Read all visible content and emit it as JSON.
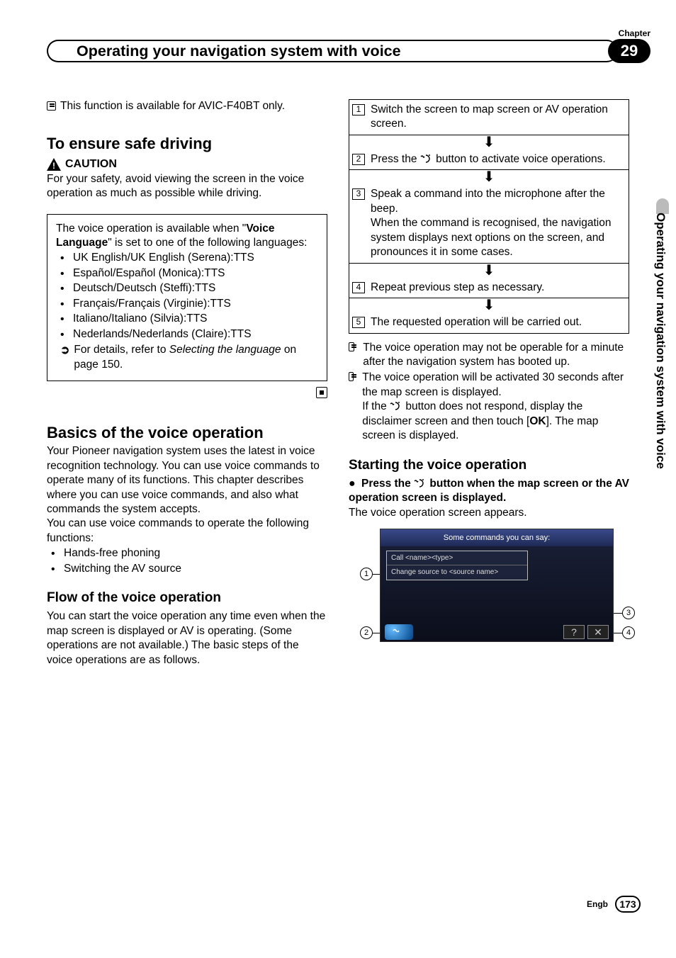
{
  "header": {
    "chapter_label": "Chapter",
    "title": "Operating your navigation system with voice",
    "chapter_num": "29",
    "side_tab": "Operating your navigation system with voice"
  },
  "left": {
    "top_note": "This function is available for AVIC-F40BT only.",
    "h_ensure": "To ensure safe driving",
    "caution_label": "CAUTION",
    "caution_body": "For your safety, avoid viewing the screen in the voice operation as much as possible while driving.",
    "box_intro_1": "The voice operation is available when \"",
    "box_intro_bold": "Voice Language",
    "box_intro_2": "\" is set to one of the following languages:",
    "langs": [
      "UK English/UK English (Serena):TTS",
      "Español/Español (Monica):TTS",
      "Deutsch/Deutsch (Steffi):TTS",
      "Français/Français (Virginie):TTS",
      "Italiano/Italiano (Silvia):TTS",
      "Nederlands/Nederlands (Claire):TTS"
    ],
    "ref_text_1": "For details, refer to ",
    "ref_text_italic": "Selecting the language",
    "ref_text_2": " on page 150.",
    "h_basics": "Basics of the voice operation",
    "basics_p1": "Your Pioneer navigation system uses the latest in voice recognition technology. You can use voice commands to operate many of its functions. This chapter describes where you can use voice commands, and also what commands the system accepts.",
    "basics_p2": "You can use voice commands to operate the following functions:",
    "basics_funcs": [
      "Hands-free phoning",
      "Switching the AV source"
    ],
    "h_flow": "Flow of the voice operation",
    "flow_p": "You can start the voice operation any time even when the map screen is displayed or AV is operating. (Some operations are not available.) The basic steps of the voice operations are as follows."
  },
  "right": {
    "steps": [
      "Switch the screen to map screen or AV operation screen.",
      "Press the  button to activate voice operations.",
      "Speak a command into the microphone after the beep.\nWhen the command is recognised, the navigation system displays next options on the screen, and pronounces it in some cases.",
      "Repeat previous step as necessary.",
      "The requested operation will be carried out."
    ],
    "step_nums": [
      "1",
      "2",
      "3",
      "4",
      "5"
    ],
    "note1": "The voice operation may not be operable for a minute after the navigation system has booted up.",
    "note2a": "The voice operation will be activated 30 seconds after the map screen is displayed.",
    "note2b_1": "If the ",
    "note2b_2": " button does not respond, display the disclaimer screen and then touch [",
    "note2b_ok": "OK",
    "note2b_3": "]. The map screen is displayed.",
    "h_start": "Starting the voice operation",
    "start_b1": "Press the ",
    "start_b2": " button when the map screen or the AV operation screen is displayed.",
    "start_after": "The voice operation screen appears.",
    "ss_header": "Some commands you can say:",
    "ss_item1": "Call <name><type>",
    "ss_item2": "Change source to <source name>",
    "callouts": [
      "1",
      "2",
      "3",
      "4"
    ]
  },
  "footer": {
    "lang": "Engb",
    "page": "173"
  }
}
